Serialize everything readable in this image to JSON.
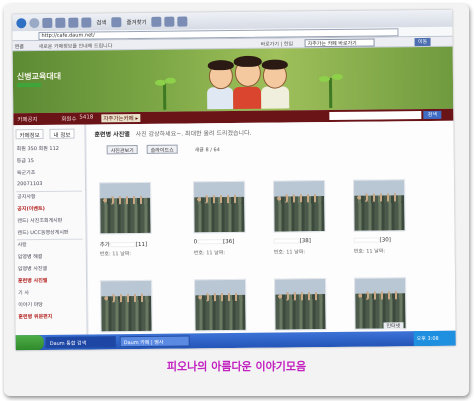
{
  "browser": {
    "toolbar_search": "검색",
    "toolbar_favorites": "즐겨찾기",
    "address": "http://cafe.daum.net/",
    "links_label": "연결",
    "links_text": "새로운 카페정보를 안내해 드립니다",
    "links_right": "바로가기 | 한입",
    "links_select": "자주가는 카페 바로가기",
    "links_go": "이동"
  },
  "cafe": {
    "name": "신병교육대대",
    "menubar": {
      "notice": "카페공지",
      "members_label": "회원수",
      "members_value": "5418",
      "tag": "자주가는카페 ▸",
      "search_button": "검색"
    }
  },
  "sidebar": {
    "tabs": [
      "카페정보",
      "내 정보"
    ],
    "rows": [
      {
        "text": "회원 350  회원 112",
        "red": false
      },
      {
        "text": "등급  15",
        "red": false
      },
      {
        "text": "육군기초",
        "red": false
      },
      {
        "text": "20071103",
        "red": false
      },
      {
        "text": "공지사항",
        "red": false
      },
      {
        "text": "공지(이벤트)",
        "red": true
      },
      {
        "text": "렌드) 사진조회게시판",
        "red": false
      },
      {
        "text": "렌드) UCC동영상게시판",
        "red": false
      },
      {
        "text": "사랑",
        "red": false
      },
      {
        "text": "입영병 해결",
        "red": false
      },
      {
        "text": "입영병 사진앨",
        "red": false
      },
      {
        "text": "훈련병 사진앨",
        "red": true
      },
      {
        "text": "기 사",
        "red": false
      },
      {
        "text": "이야기 마당",
        "red": false
      },
      {
        "text": "훈련병 위문편지",
        "red": true
      }
    ]
  },
  "board": {
    "title": "훈련병 사진앨",
    "description": "사진 감상하세요~. 최대한 올려 드리겠습니다.",
    "btn_slideshow": "사진관보기",
    "btn_upload": "슬라이드쇼",
    "count_text": "새글 8 / 64",
    "row1": [
      {
        "label": "추가",
        "num": "[11]",
        "meta": "번호: 11  날짜: ",
        "has_label": true
      },
      {
        "label": "0",
        "num": "[36]",
        "meta": "번호: 11  날짜: ",
        "has_label": true
      },
      {
        "label": "",
        "num": "[38]",
        "meta": "번호: 11  날짜: ",
        "has_label": true
      },
      {
        "label": "",
        "num": "[30]",
        "meta": "번호: 11  날짜: ",
        "has_label": true
      }
    ],
    "row2_count": 4
  },
  "taskbar": {
    "tasks": [
      "Daum 통합 검색",
      "Daum 카페 | 병사"
    ],
    "time": "오후 3:08",
    "status": "인터넷"
  },
  "caption": "피오나의 아름다운 이야기모음",
  "colors": {
    "menubar": "#6b1418",
    "banner_green": "#7fa947",
    "caption": "#c21fbf",
    "taskbar": "#2455b8"
  }
}
